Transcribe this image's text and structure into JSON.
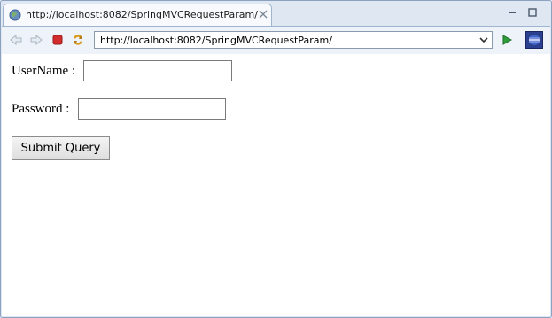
{
  "tab": {
    "title": "http://localhost:8082/SpringMVCRequestParam/"
  },
  "toolbar": {
    "url": "http://localhost:8082/SpringMVCRequestParam/"
  },
  "form": {
    "username_label": "UserName :",
    "username_value": "",
    "password_label": "Password :",
    "password_value": "",
    "submit_label": "Submit Query"
  },
  "icons": {
    "tab": "globe-icon",
    "tab_close": "close-icon",
    "minimize": "minimize-icon",
    "maximize": "maximize-icon",
    "back": "back-arrow-icon",
    "forward": "forward-arrow-icon",
    "stop": "stop-icon",
    "refresh": "refresh-icon",
    "go": "go-arrow-icon",
    "eclipse": "eclipse-icon"
  },
  "colors": {
    "window_bg": "#dfe7f2",
    "stop_red": "#d22c2c",
    "go_green": "#2f9c3a"
  }
}
